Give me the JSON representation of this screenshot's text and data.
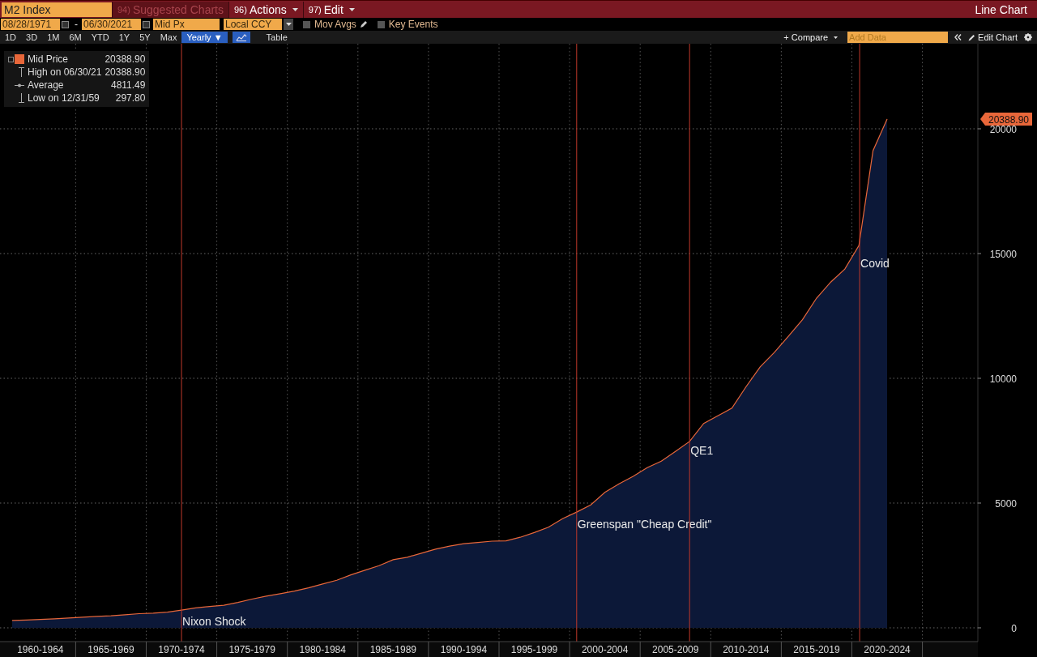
{
  "title_bar": {
    "security": "M2 Index",
    "menu": [
      {
        "number": "94)",
        "label": "Suggested Charts",
        "disabled": true
      },
      {
        "number": "96)",
        "label": "Actions",
        "disabled": false
      },
      {
        "number": "97)",
        "label": "Edit",
        "disabled": false
      }
    ],
    "title": "Line Chart"
  },
  "controls": {
    "start_date": "08/28/1971",
    "separator": "-",
    "end_date": "06/30/2021",
    "field": "Mid Px",
    "currency": "Local CCY",
    "checkboxes": [
      {
        "label": "Mov Avgs",
        "checked": false,
        "kind": "edit"
      },
      {
        "label": "Key Events",
        "checked": false,
        "kind": "plain"
      }
    ]
  },
  "periods": [
    {
      "label": "1D",
      "selected": false
    },
    {
      "label": "3D",
      "selected": false
    },
    {
      "label": "1M",
      "selected": false
    },
    {
      "label": "6M",
      "selected": false
    },
    {
      "label": "YTD",
      "selected": false
    },
    {
      "label": "1Y",
      "selected": false
    },
    {
      "label": "5Y",
      "selected": false
    },
    {
      "label": "Max",
      "selected": false
    },
    {
      "label": "Yearly ▼",
      "selected": true
    }
  ],
  "views": [
    {
      "kind": "icon",
      "selected": true
    },
    {
      "kind": "text",
      "label": "Table",
      "selected": false
    }
  ],
  "tools": {
    "compare": "+ Compare",
    "add_data_placeholder": "Add Data",
    "edit_chart": "Edit Chart"
  },
  "legend": [
    {
      "kind": "series",
      "value": "20388.90"
    },
    {
      "kind": "high",
      "label": "High on 06/30/21",
      "value": "20388.90"
    },
    {
      "kind": "average",
      "label": "Average",
      "value": "4811.49"
    },
    {
      "kind": "low",
      "label": "Low on 12/31/59",
      "value": "297.80"
    }
  ],
  "chart": {
    "last_value_label": "20388.90",
    "chart_data": {
      "type": "area",
      "categories": [
        null,
        null,
        "1960-1964",
        null,
        null,
        null,
        null,
        "1965-1969",
        null,
        null,
        null,
        null,
        "1970-1974",
        null,
        null,
        null,
        null,
        "1975-1979",
        null,
        null,
        null,
        null,
        "1980-1984",
        null,
        null,
        null,
        null,
        "1985-1989",
        null,
        null,
        null,
        null,
        "1990-1994",
        null,
        null,
        null,
        null,
        "1995-1999",
        null,
        null,
        null,
        null,
        "2000-2004",
        null,
        null,
        null,
        null,
        "2005-2009",
        null,
        null,
        null,
        null,
        "2010-2014",
        null,
        null,
        null,
        null,
        "2015-2019",
        null,
        null,
        null,
        null,
        "2020-2024"
      ],
      "series": [
        {
          "name": "Mid Price",
          "color": "#e8673a",
          "values": [
            298,
            312,
            335,
            362,
            393,
            424,
            459,
            480,
            525,
            567,
            588,
            627,
            710,
            802,
            855,
            902,
            1017,
            1152,
            1270,
            1366,
            1474,
            1600,
            1756,
            1906,
            2124,
            2307,
            2494,
            2731,
            2831,
            2994,
            3153,
            3272,
            3372,
            3423,
            3474,
            3486,
            3630,
            3819,
            4033,
            4375,
            4638,
            4925,
            5433,
            5772,
            6067,
            6419,
            6681,
            7071,
            7471,
            8192,
            8496,
            8801,
            9660,
            10460,
            11035,
            11685,
            12346,
            13215,
            13857,
            14379,
            15326,
            19126,
            20389
          ]
        }
      ],
      "ylim": [
        -552,
        23409
      ],
      "grid": true,
      "yticks": [
        0,
        5000,
        10000,
        15000,
        20000
      ],
      "annotations": [
        {
          "text": "Nixon Shock"
        },
        {
          "text": "Greenspan \"Cheap Credit\""
        },
        {
          "text": "QE1"
        },
        {
          "text": "Covid"
        }
      ]
    }
  }
}
